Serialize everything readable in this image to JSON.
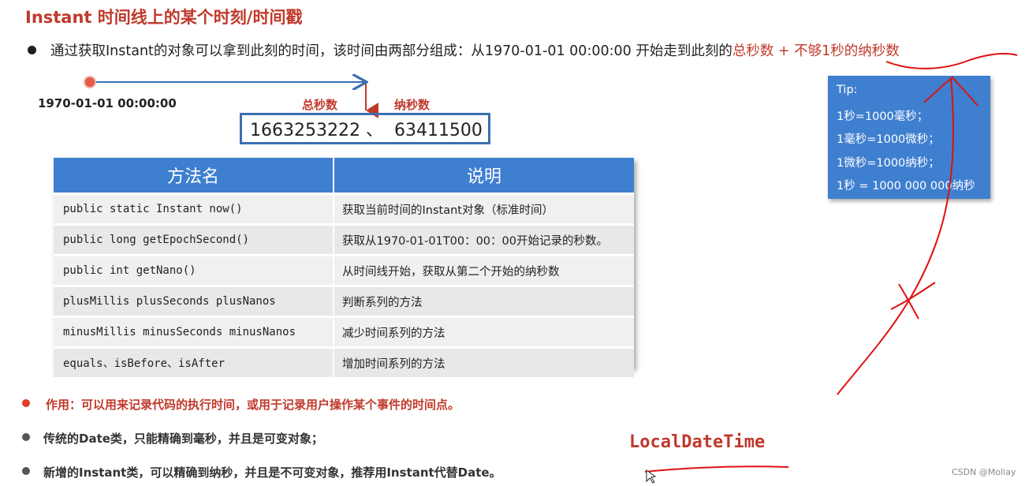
{
  "title": "Instant 时间线上的某个时刻/时间戳",
  "intro": {
    "text_before": "通过获取Instant的对象可以拿到此刻的时间，该时间由两部分组成：从1970-01-01 00:00:00 开始走到此刻的",
    "text_highlight": "总秒数 + 不够1秒的纳秒数"
  },
  "timeline": {
    "epoch_label": "1970-01-01 00:00:00",
    "seconds_label": "总秒数",
    "nanos_label": "纳秒数",
    "value_text": "1663253222 、  63411500"
  },
  "table": {
    "headers": [
      "方法名",
      "说明"
    ],
    "rows": [
      {
        "method": "public static Instant now()",
        "desc": "获取当前时间的Instant对象（标准时间）"
      },
      {
        "method": "public long getEpochSecond()",
        "desc": "获取从1970-01-01T00：00：00开始记录的秒数。"
      },
      {
        "method": "public int getNano()",
        "desc": "从时间线开始，获取从第二个开始的纳秒数"
      },
      {
        "method": "plusMillis plusSeconds plusNanos",
        "desc": "判断系列的方法"
      },
      {
        "method": "minusMillis minusSeconds minusNanos",
        "desc": "减少时间系列的方法"
      },
      {
        "method": "equals、isBefore、isAfter",
        "desc": "增加时间系列的方法"
      }
    ]
  },
  "tip": {
    "lines": [
      "Tip:",
      "1秒=1000毫秒；",
      "1毫秒=1000微秒；",
      "1微秒=1000纳秒；",
      "1秒 = 1000 000 000纳秒"
    ]
  },
  "bullets": [
    "作用：可以用来记录代码的执行时间，或用于记录用户操作某个事件的时间点。",
    "传统的Date类，只能精确到毫秒，并且是可变对象；",
    "新增的Instant类，可以精确到纳秒，并且是不可变对象，推荐用Instant代替Date。"
  ],
  "annotation": "LocalDateTime",
  "watermark": "CSDN @Moliay",
  "colors": {
    "accent_red": "#c0392b",
    "accent_blue": "#3f7fcf",
    "box_border": "#3b6fb3"
  }
}
